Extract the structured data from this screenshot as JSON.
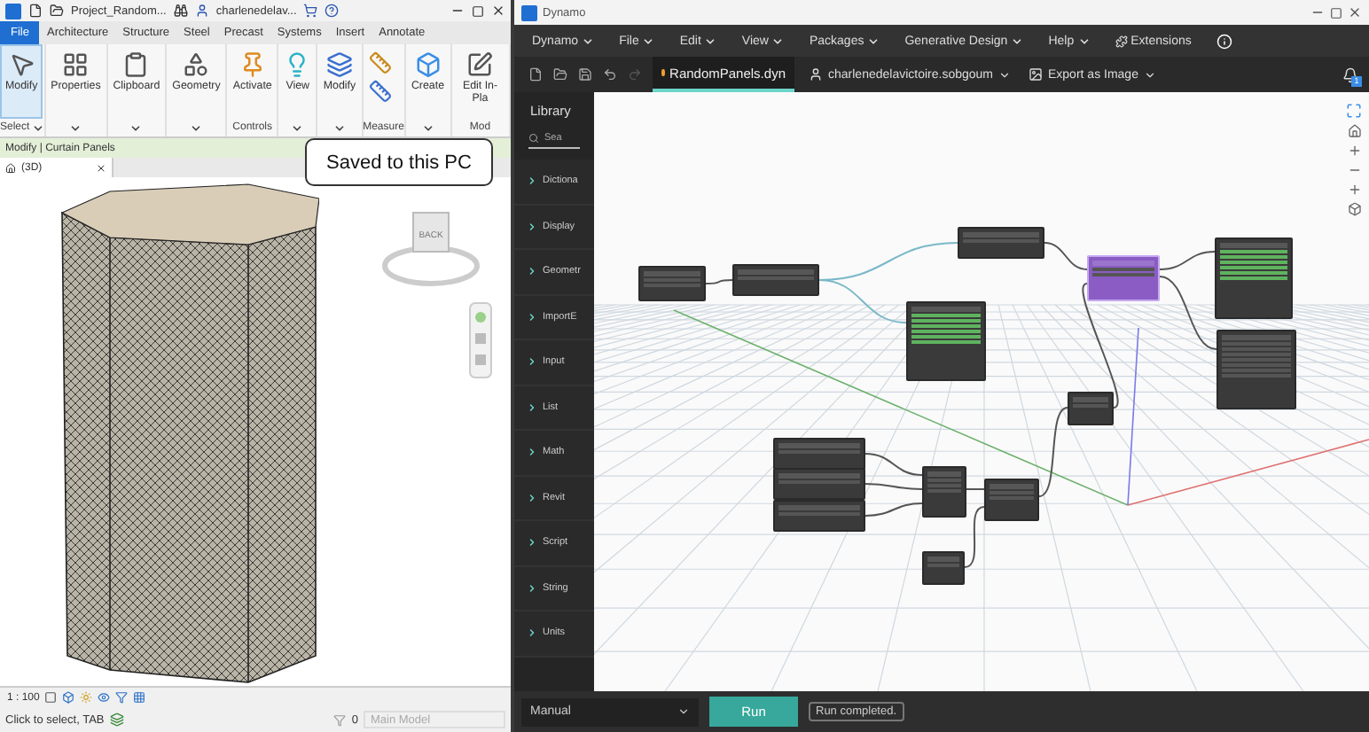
{
  "revit": {
    "title_bar": {
      "project": "Project_Random...",
      "user": "charlenedelav..."
    },
    "file_button": "File",
    "ribbon_tabs": [
      "Architecture",
      "Structure",
      "Steel",
      "Precast",
      "Systems",
      "Insert",
      "Annotate"
    ],
    "ribbon_panels": [
      {
        "label": "Select",
        "dropdown": true,
        "tools": [
          {
            "kind": "pointer",
            "label": "Modify",
            "selected": true
          }
        ]
      },
      {
        "dropdown": true,
        "tools": [
          {
            "kind": "properties",
            "label": "Properties",
            "selected": false
          }
        ]
      },
      {
        "dropdown": true,
        "tools": [
          {
            "kind": "clipboard",
            "label": "Clipboard",
            "selected": false
          }
        ]
      },
      {
        "dropdown": true,
        "tools": [
          {
            "kind": "geometry",
            "label": "Geometry",
            "selected": false
          }
        ]
      },
      {
        "label": "Controls",
        "dropdown": false,
        "tools": [
          {
            "kind": "activate",
            "label": "Activate",
            "selected": false
          }
        ]
      },
      {
        "dropdown": true,
        "tools": [
          {
            "kind": "view",
            "label": "View",
            "selected": false
          }
        ]
      },
      {
        "dropdown": true,
        "tools": [
          {
            "kind": "modify",
            "label": "Modify",
            "selected": false
          }
        ]
      },
      {
        "label": "Measure",
        "dropdown": false,
        "tools": [
          {
            "kind": "measure",
            "selected": false
          }
        ]
      },
      {
        "dropdown": true,
        "tools": [
          {
            "kind": "create",
            "label": "Create",
            "selected": false
          }
        ]
      },
      {
        "label": "Mod",
        "dropdown": false,
        "tools": [
          {
            "kind": "edit",
            "label": "Edit In-Pla",
            "selected": false
          }
        ]
      }
    ],
    "context_bar": "Modify | Curtain Panels",
    "view_tab": "(3D)",
    "viewcube_label": "BACK",
    "toast": "Saved to this PC",
    "scale": "1 : 100",
    "status_text": "Click to select, TAB",
    "selection_count": "0",
    "workset": "Main Model"
  },
  "dynamo": {
    "title": "Dynamo",
    "menus": [
      {
        "label": "Dynamo",
        "dropdown": true
      },
      {
        "label": "File",
        "dropdown": true
      },
      {
        "label": "Edit",
        "dropdown": true
      },
      {
        "label": "View",
        "dropdown": true
      },
      {
        "label": "Packages",
        "dropdown": true
      },
      {
        "label": "Generative Design",
        "dropdown": true
      },
      {
        "label": "Help",
        "dropdown": true
      },
      {
        "label": "Extensions",
        "dropdown": false
      }
    ],
    "document_tab": {
      "label": "RandomPanels.dyn",
      "unsaved": true,
      "selected": true
    },
    "account": "charlenedelavictoire.sobgoum",
    "export_button": "Export as Image",
    "notification_count": "1",
    "library": {
      "title": "Library",
      "search_placeholder": "Sea",
      "items": [
        "Dictiona",
        "Display",
        "Geometr",
        "ImportE",
        "Input",
        "List",
        "Math",
        "Revit",
        "Script",
        "String",
        "Units"
      ]
    },
    "run_mode": "Manual",
    "run_button": "Run",
    "run_status": "Run completed."
  }
}
